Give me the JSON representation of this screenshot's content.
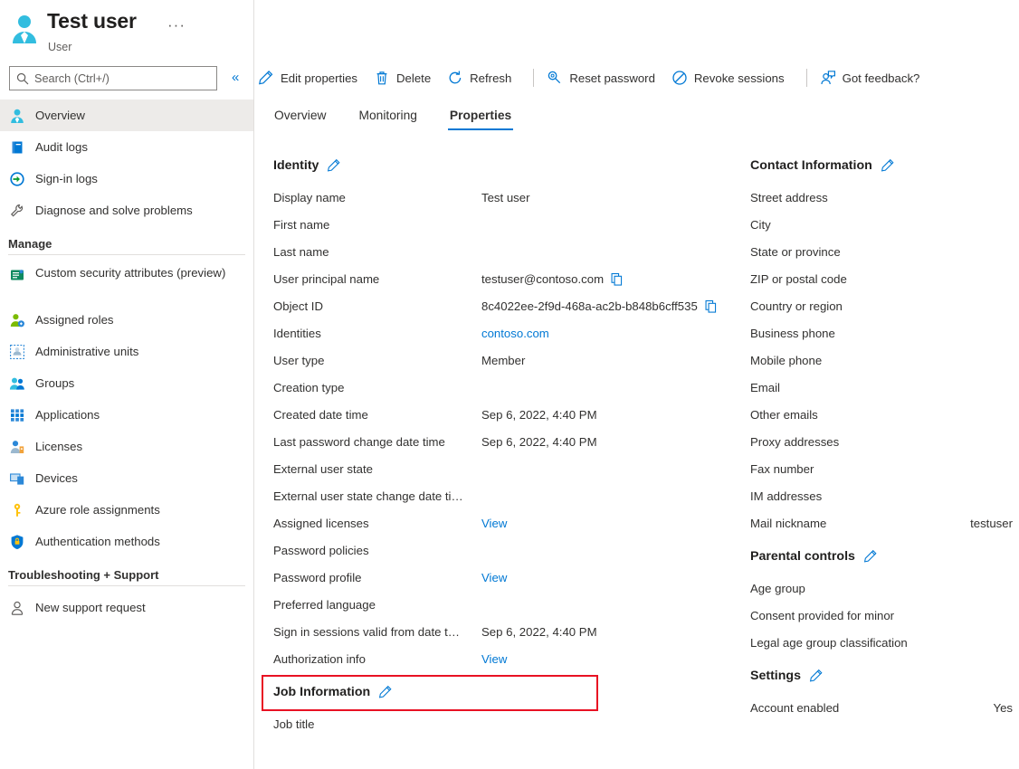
{
  "resource": {
    "title": "Test user",
    "subtitle": "User",
    "avatar_icon": "user-avatar-icon",
    "more_label": "···"
  },
  "search": {
    "placeholder": "Search (Ctrl+/)",
    "value": "",
    "icon": "search-icon",
    "collapse_icon": "chevron-double-left-icon",
    "collapse_label": "«"
  },
  "sidebar": {
    "items": [
      {
        "label": "Overview",
        "icon": "user-icon",
        "selected": true
      },
      {
        "label": "Audit logs",
        "icon": "book-icon",
        "selected": false
      },
      {
        "label": "Sign-in logs",
        "icon": "sign-in-arrow-icon",
        "selected": false
      },
      {
        "label": "Diagnose and solve problems",
        "icon": "wrench-icon",
        "selected": false
      }
    ],
    "groups": [
      {
        "label": "Manage",
        "items": [
          {
            "label": "Custom security attributes (preview)",
            "icon": "security-attributes-icon",
            "two_line": true
          },
          {
            "label": "Assigned roles",
            "icon": "assigned-roles-icon",
            "two_line": false
          },
          {
            "label": "Administrative units",
            "icon": "administrative-units-icon",
            "two_line": false
          },
          {
            "label": "Groups",
            "icon": "groups-icon",
            "two_line": false
          },
          {
            "label": "Applications",
            "icon": "applications-grid-icon",
            "two_line": false
          },
          {
            "label": "Licenses",
            "icon": "licenses-icon",
            "two_line": false
          },
          {
            "label": "Devices",
            "icon": "devices-icon",
            "two_line": false
          },
          {
            "label": "Azure role assignments",
            "icon": "key-icon",
            "two_line": false
          },
          {
            "label": "Authentication methods",
            "icon": "shield-lock-icon",
            "two_line": false
          }
        ]
      },
      {
        "label": "Troubleshooting + Support",
        "items": [
          {
            "label": "New support request",
            "icon": "support-person-icon",
            "two_line": false
          }
        ]
      }
    ]
  },
  "toolbar": {
    "buttons": [
      {
        "label": "Edit properties",
        "icon": "pencil-icon"
      },
      {
        "label": "Delete",
        "icon": "trash-icon"
      },
      {
        "label": "Refresh",
        "icon": "refresh-icon"
      },
      {
        "divider": true
      },
      {
        "label": "Reset password",
        "icon": "key-search-icon"
      },
      {
        "label": "Revoke sessions",
        "icon": "block-circle-icon"
      },
      {
        "divider": true
      },
      {
        "label": "Got feedback?",
        "icon": "feedback-person-icon"
      }
    ]
  },
  "tabs": [
    {
      "label": "Overview",
      "active": false
    },
    {
      "label": "Monitoring",
      "active": false
    },
    {
      "label": "Properties",
      "active": true
    }
  ],
  "sections": {
    "identity": {
      "title": "Identity",
      "edit_icon": "pencil-icon",
      "rows": [
        {
          "label": "Display name",
          "value": "Test user",
          "kind": "text"
        },
        {
          "label": "First name",
          "value": "",
          "kind": "text"
        },
        {
          "label": "Last name",
          "value": "",
          "kind": "text"
        },
        {
          "label": "User principal name",
          "value": "testuser@contoso.com",
          "kind": "copy"
        },
        {
          "label": "Object ID",
          "value": "8c4022ee-2f9d-468a-ac2b-b848b6cff535",
          "kind": "copy"
        },
        {
          "label": "Identities",
          "value": "contoso.com",
          "kind": "link"
        },
        {
          "label": "User type",
          "value": "Member",
          "kind": "text"
        },
        {
          "label": "Creation type",
          "value": "",
          "kind": "text"
        },
        {
          "label": "Created date time",
          "value": "Sep 6, 2022, 4:40 PM",
          "kind": "text"
        },
        {
          "label": "Last password change date time",
          "value": "Sep 6, 2022, 4:40 PM",
          "kind": "text"
        },
        {
          "label": "External user state",
          "value": "",
          "kind": "text"
        },
        {
          "label": "External user state change date ti…",
          "value": "",
          "kind": "text"
        },
        {
          "label": "Assigned licenses",
          "value": "View",
          "kind": "link"
        },
        {
          "label": "Password policies",
          "value": "",
          "kind": "text"
        },
        {
          "label": "Password profile",
          "value": "View",
          "kind": "link"
        },
        {
          "label": "Preferred language",
          "value": "",
          "kind": "text"
        },
        {
          "label": "Sign in sessions valid from date t…",
          "value": "Sep 6, 2022, 4:40 PM",
          "kind": "text"
        },
        {
          "label": "Authorization info",
          "value": "View",
          "kind": "link",
          "highlighted": true
        }
      ]
    },
    "job_information": {
      "title": "Job Information",
      "edit_icon": "pencil-icon",
      "rows": [
        {
          "label": "Job title",
          "value": "",
          "kind": "text"
        }
      ]
    },
    "contact_information": {
      "title": "Contact Information",
      "edit_icon": "pencil-icon",
      "rows": [
        {
          "label": "Street address",
          "value": ""
        },
        {
          "label": "City",
          "value": ""
        },
        {
          "label": "State or province",
          "value": ""
        },
        {
          "label": "ZIP or postal code",
          "value": ""
        },
        {
          "label": "Country or region",
          "value": ""
        },
        {
          "label": "Business phone",
          "value": ""
        },
        {
          "label": "Mobile phone",
          "value": ""
        },
        {
          "label": "Email",
          "value": ""
        },
        {
          "label": "Other emails",
          "value": ""
        },
        {
          "label": "Proxy addresses",
          "value": ""
        },
        {
          "label": "Fax number",
          "value": ""
        },
        {
          "label": "IM addresses",
          "value": ""
        },
        {
          "label": "Mail nickname",
          "value": "testuser"
        }
      ]
    },
    "parental_controls": {
      "title": "Parental controls",
      "edit_icon": "pencil-icon",
      "rows": [
        {
          "label": "Age group",
          "value": ""
        },
        {
          "label": "Consent provided for minor",
          "value": ""
        },
        {
          "label": "Legal age group classification",
          "value": ""
        }
      ]
    },
    "settings": {
      "title": "Settings",
      "edit_icon": "pencil-icon",
      "rows": [
        {
          "label": "Account enabled",
          "value": "Yes"
        }
      ]
    }
  },
  "colors": {
    "accent": "#0078d4",
    "highlight_border": "#e81123",
    "selected_nav_bg": "#edebe9",
    "text": "#323130",
    "muted_text": "#605e5c"
  }
}
